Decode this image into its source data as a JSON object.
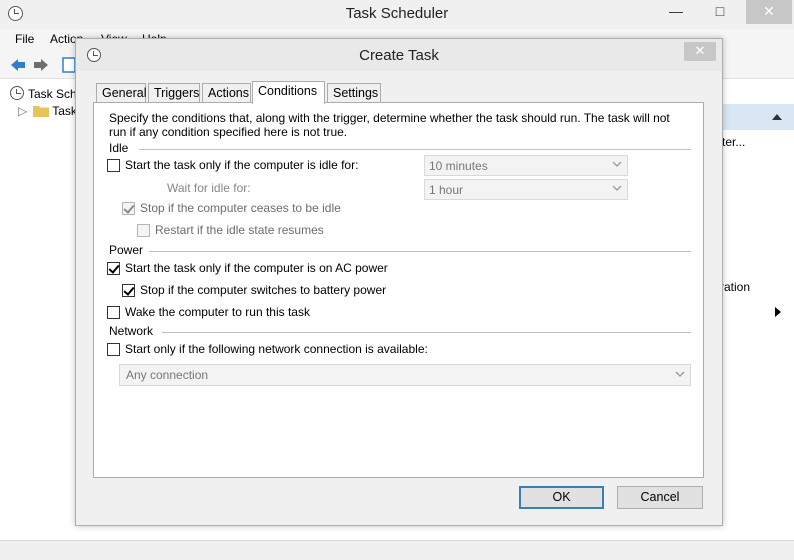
{
  "main_window": {
    "title": "Task Scheduler",
    "menu": [
      "File",
      "Action",
      "View",
      "Help"
    ],
    "tree": [
      "Task Sch",
      "Task"
    ],
    "right_panel": [
      "ter...",
      "ration"
    ]
  },
  "dialog": {
    "title": "Create Task",
    "close_symbol": "✕",
    "tabs": [
      "General",
      "Triggers",
      "Actions",
      "Conditions",
      "Settings"
    ],
    "active_tab": "Conditions",
    "description_line1": "Specify the conditions that, along with the trigger, determine whether the task should run.  The task will not",
    "description_line2": "run  if any condition specified here is not true.",
    "idle": {
      "label": "Idle",
      "start_idle_label": "Start the task only if the computer is idle for:",
      "start_idle_checked": false,
      "idle_for_value": "10 minutes",
      "wait_label": "Wait for idle for:",
      "wait_value": "1 hour",
      "stop_idle_label": "Stop if the computer ceases to be idle",
      "stop_idle_checked": true,
      "restart_label": "Restart if the idle state resumes",
      "restart_checked": false
    },
    "power": {
      "label": "Power",
      "ac_power_label": "Start the task only if the computer is on AC power",
      "ac_power_checked": true,
      "battery_label": "Stop if the computer switches to battery power",
      "battery_checked": true,
      "wake_label": "Wake the computer to run this task",
      "wake_checked": false
    },
    "network": {
      "label": "Network",
      "start_network_label": "Start only if the following network connection is available:",
      "start_network_checked": false,
      "connection_value": "Any connection"
    },
    "buttons": {
      "ok": "OK",
      "cancel": "Cancel"
    }
  }
}
